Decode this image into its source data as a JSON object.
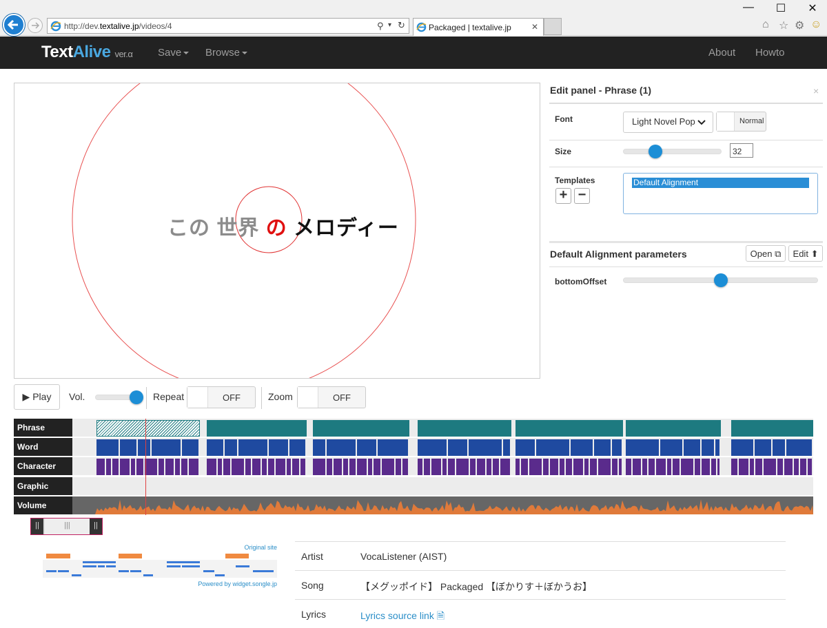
{
  "browser": {
    "url_prefix": "http://dev.",
    "url_domain": "textalive.jp",
    "url_path": "/videos/4",
    "tab_title": "Packaged | textalive.jp"
  },
  "navbar": {
    "logo_text": "Text",
    "logo_accent": "Alive",
    "logo_version": "ver.α",
    "save_label": "Save",
    "browse_label": "Browse",
    "about_label": "About",
    "howto_label": "Howto"
  },
  "stage": {
    "lyric_gray": "この 世界",
    "lyric_red": "の",
    "lyric_black": "メロディー"
  },
  "edit_panel": {
    "title": "Edit panel - Phrase (1)",
    "close": "×",
    "font_label": "Font",
    "font_value": "Light Novel Pop",
    "font_style": "Normal",
    "size_label": "Size",
    "size_value": "32",
    "size_fraction": 0.3,
    "templates_label": "Templates",
    "template_items": [
      "Default Alignment"
    ],
    "params_title": "Default Alignment parameters",
    "open_label": "Open",
    "edit_label": "Edit",
    "param_name": "bottomOffset",
    "param_fraction": 0.5
  },
  "controls": {
    "play_label": "Play",
    "vol_label": "Vol.",
    "vol_fraction": 1.0,
    "repeat_label": "Repeat",
    "repeat_value": "OFF",
    "zoom_label": "Zoom",
    "zoom_value": "OFF"
  },
  "timeline": {
    "rows": [
      "Phrase",
      "Word",
      "Character",
      "Graphic",
      "Volume"
    ],
    "colors": {
      "phrase": "#1d7a80",
      "word": "#1f4aa0",
      "character": "#5a2b8c",
      "volume": "#e07a3a",
      "volume_bg": "#666666",
      "cursor": "#e04040"
    }
  },
  "songle": {
    "original_site": "Original site",
    "powered_by": "Powered by widget.songle.jp"
  },
  "info": {
    "artist_label": "Artist",
    "artist_value": "VocaListener (AIST)",
    "song_label": "Song",
    "song_value": "【メグッポイド】 Packaged 【ぼかりす＋ぼかうお】",
    "lyrics_label": "Lyrics",
    "lyrics_value": "Lyrics source link"
  }
}
